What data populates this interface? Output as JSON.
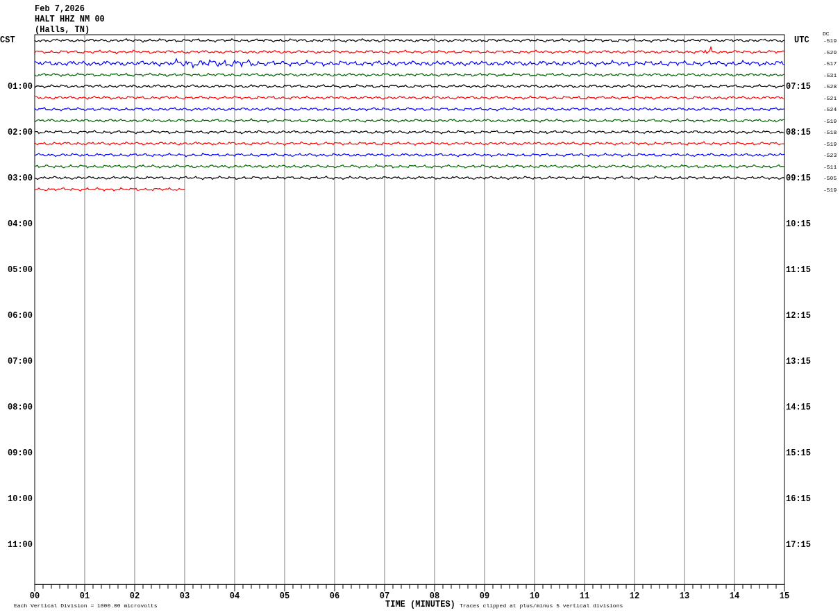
{
  "header": {
    "date": "Feb 7,2026",
    "station": "HALT HHZ NM 00",
    "location": "(Halls, TN)"
  },
  "time_zones": {
    "left": "CST",
    "right": "UTC"
  },
  "dc_label": "DC",
  "left_hours": [
    "01:00",
    "02:00",
    "03:00",
    "04:00",
    "05:00",
    "06:00",
    "07:00",
    "08:00",
    "09:00",
    "10:00",
    "11:00"
  ],
  "right_hours": [
    "07:15",
    "08:15",
    "09:15",
    "10:15",
    "11:15",
    "12:15",
    "13:15",
    "14:15",
    "15:15",
    "16:15",
    "17:15"
  ],
  "traces": [
    {
      "color": "#000000",
      "complete": true,
      "dc": "-519"
    },
    {
      "color": "#ff0000",
      "complete": true,
      "dc": "-529"
    },
    {
      "color": "#0000ff",
      "complete": true,
      "dc": "-517"
    },
    {
      "color": "#006400",
      "complete": true,
      "dc": "-531"
    },
    {
      "color": "#000000",
      "complete": true,
      "dc": "-528"
    },
    {
      "color": "#ff0000",
      "complete": true,
      "dc": "-521"
    },
    {
      "color": "#0000ff",
      "complete": true,
      "dc": "-524"
    },
    {
      "color": "#006400",
      "complete": true,
      "dc": "-519"
    },
    {
      "color": "#000000",
      "complete": true,
      "dc": "-518"
    },
    {
      "color": "#ff0000",
      "complete": true,
      "dc": "-519"
    },
    {
      "color": "#0000ff",
      "complete": true,
      "dc": "-523"
    },
    {
      "color": "#006400",
      "complete": true,
      "dc": "-511"
    },
    {
      "color": "#000000",
      "complete": true,
      "dc": "-505"
    },
    {
      "color": "#ff0000",
      "complete": false,
      "dc": "-519"
    }
  ],
  "x_ticks": [
    "00",
    "01",
    "02",
    "03",
    "04",
    "05",
    "06",
    "07",
    "08",
    "09",
    "10",
    "11",
    "12",
    "13",
    "14",
    "15"
  ],
  "footer": {
    "scale": "Each Vertical Division = 1000.00 microvolts",
    "axis_title": "TIME (MINUTES)",
    "clipping": "Traces clipped at plus/minus 5 vertical divisions"
  }
}
